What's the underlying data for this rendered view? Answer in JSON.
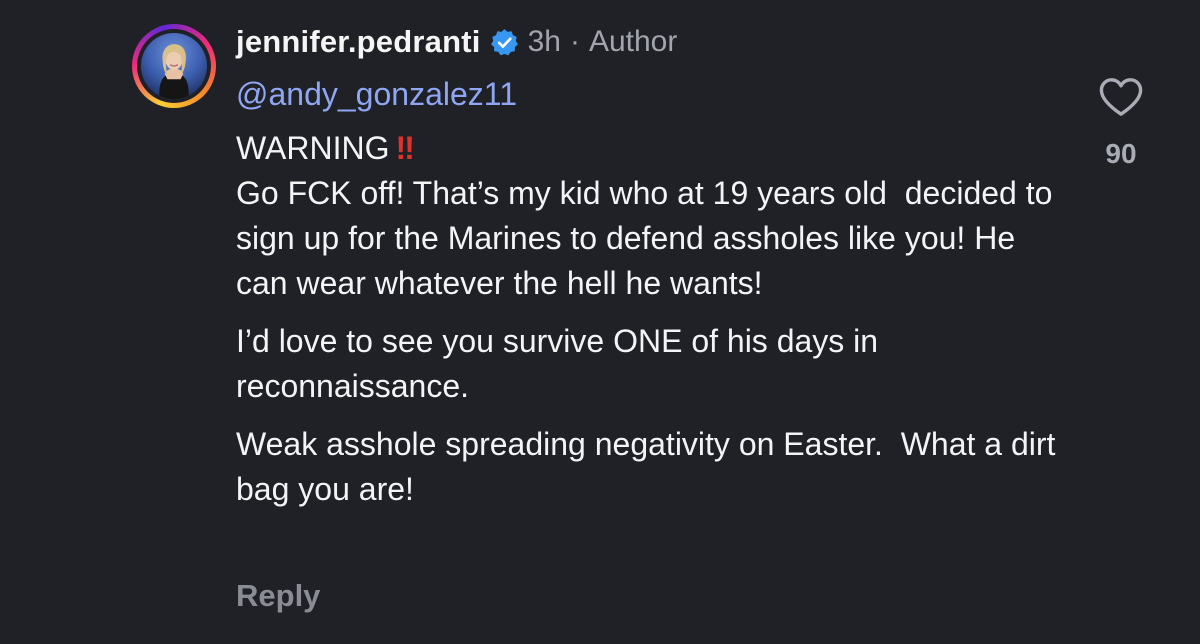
{
  "comment": {
    "username": "jennifer.pedranti",
    "verified_icon": "verified-badge-icon",
    "time": "3h",
    "separator": "·",
    "role": "Author",
    "mention": "@andy_gonzalez11",
    "warning_text": "WARNING",
    "warning_emoji": "‼",
    "paragraph_1": "Go FCK off! That’s my kid who at 19 years old  decided to sign up for the Marines to defend assholes like you! He can wear whatever the hell he wants!",
    "paragraph_2": "I’d love to see you survive ONE of his days in reconnaissance.",
    "paragraph_3": "Weak asshole spreading negativity on Easter.  What a dirt bag you are!",
    "reply_label": "Reply",
    "like_icon": "heart-icon",
    "like_count": "90"
  },
  "colors": {
    "background": "#202126",
    "mention": "#8fa6f4",
    "verified": "#3897f0",
    "warning_emoji": "#e0312b",
    "muted": "#a2a5ad"
  }
}
